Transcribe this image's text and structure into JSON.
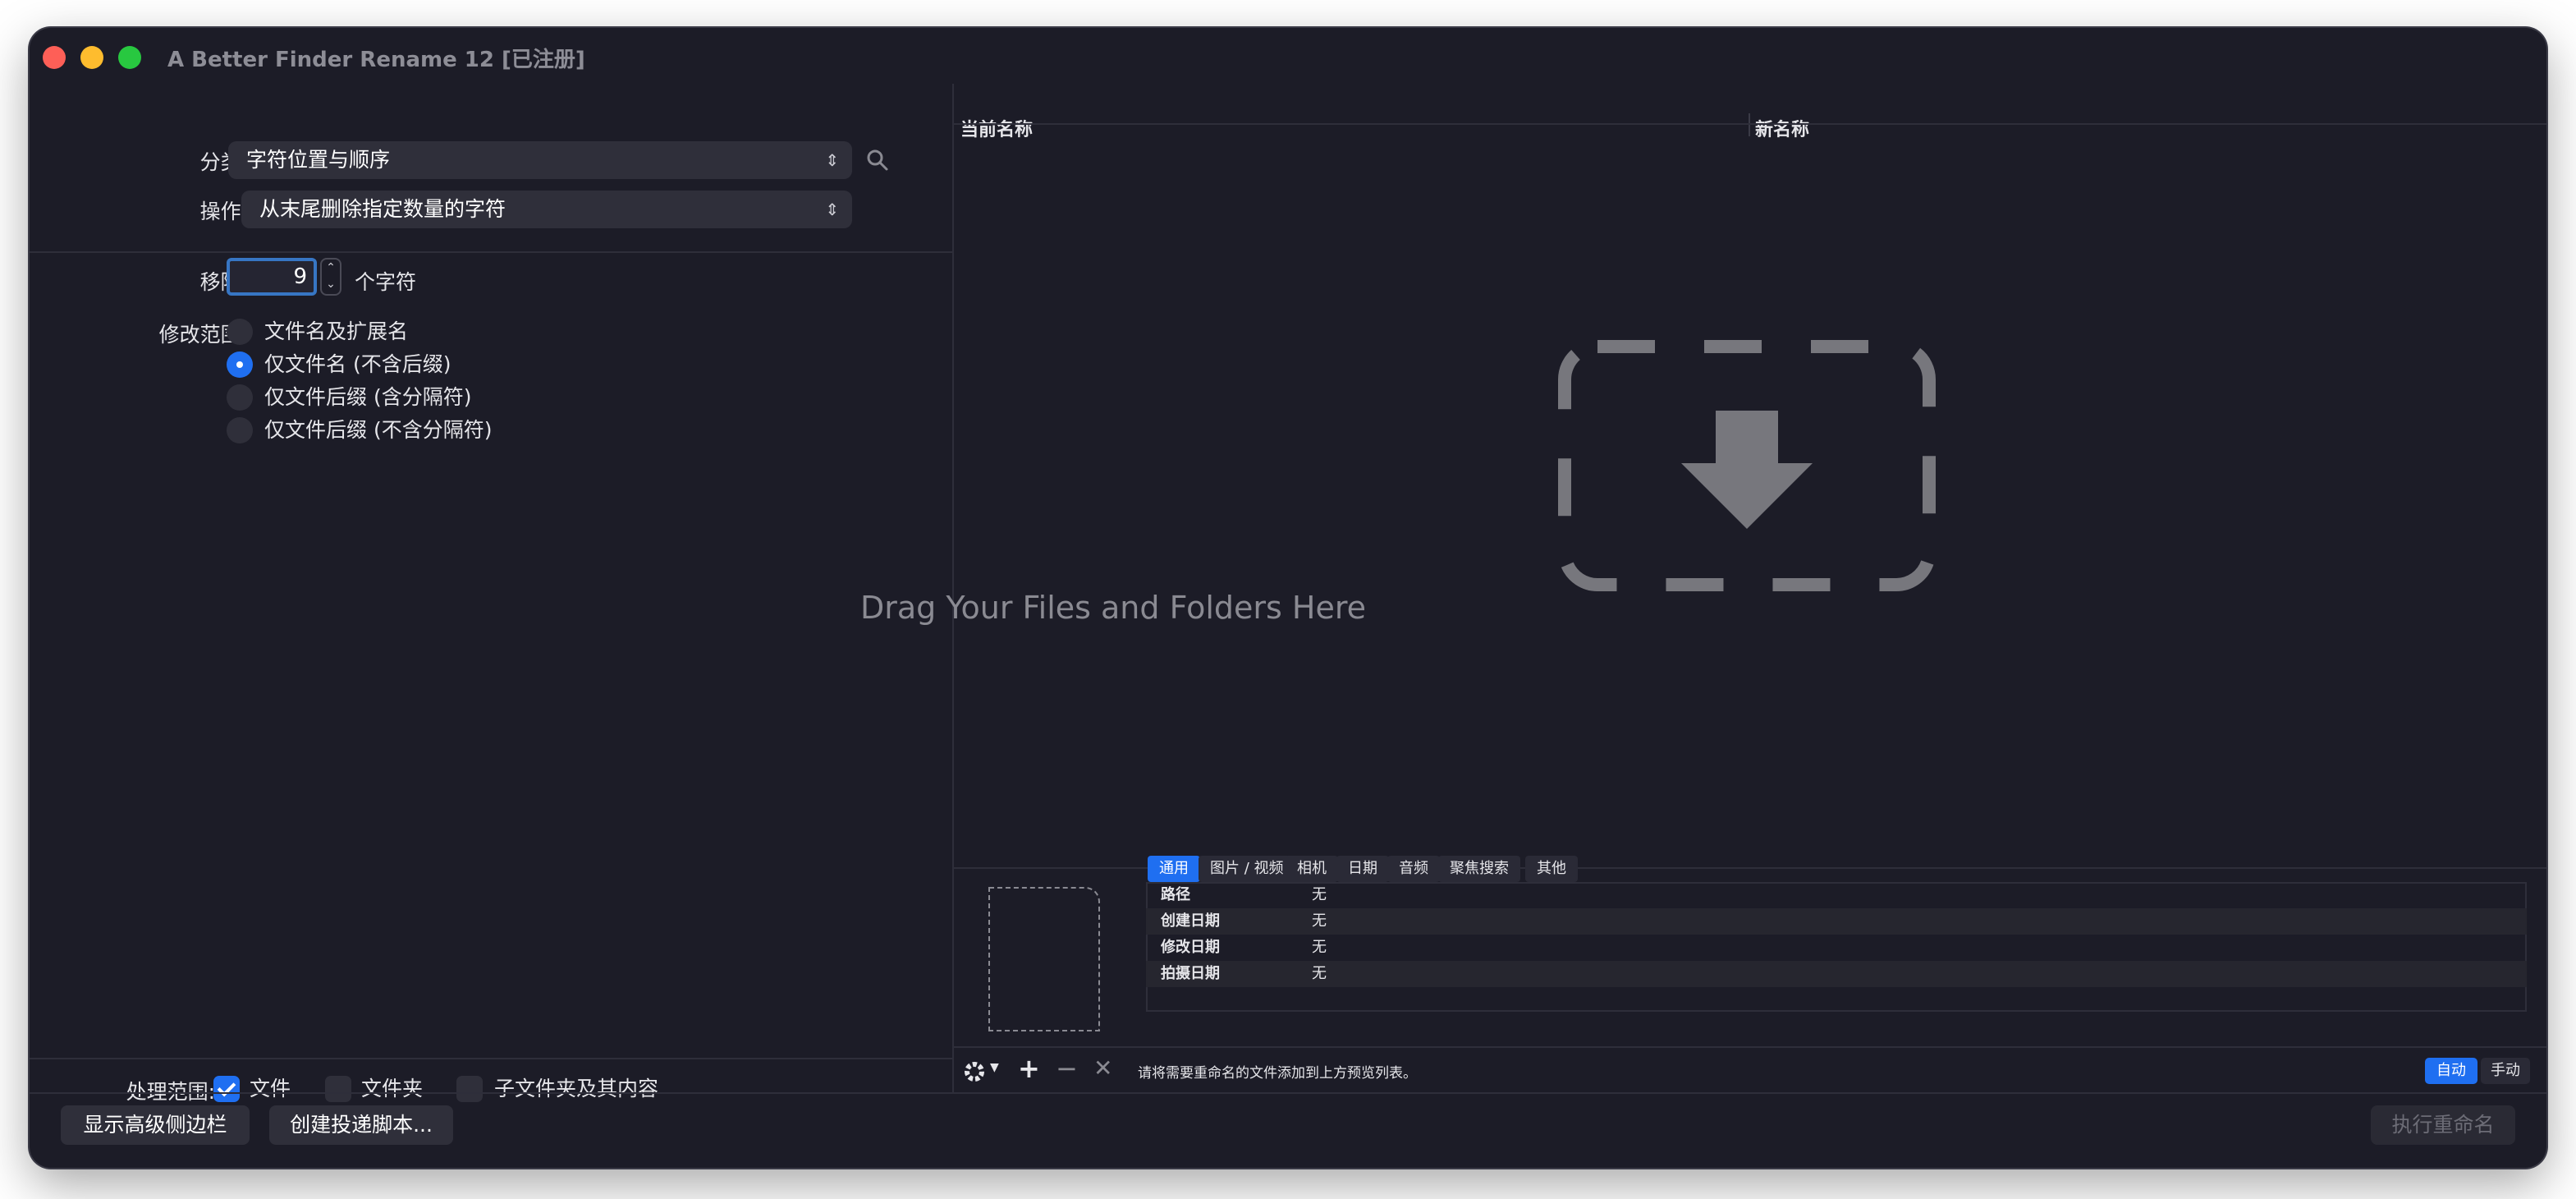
{
  "window": {
    "title": "A Better Finder Rename 12 [已注册]"
  },
  "left": {
    "category_label": "分类:",
    "category_value": "字符位置与顺序",
    "action_label": "操作:",
    "action_value": "从末尾删除指定数量的字符",
    "remove_label": "移除:",
    "remove_value": "9",
    "remove_unit": "个字符",
    "scope_label": "修改范围:",
    "scope_options": [
      "文件名及扩展名",
      "仅文件名 (不含后缀)",
      "仅文件后缀 (含分隔符)",
      "仅文件后缀 (不含分隔符)"
    ],
    "scope_selected": 1,
    "process_label": "处理范围:",
    "process_options": [
      {
        "label": "文件",
        "checked": true
      },
      {
        "label": "文件夹",
        "checked": false
      },
      {
        "label": "子文件夹及其内容",
        "checked": false
      }
    ]
  },
  "right": {
    "col_current": "当前名称",
    "col_new": "新名称",
    "drop_hint": "Drag Your Files and Folders Here",
    "tabs": [
      "通用",
      "图片 / 视频",
      "相机",
      "日期",
      "音频",
      "聚焦搜索",
      "其他"
    ],
    "active_tab": 0,
    "info_rows": [
      {
        "key": "路径",
        "value": "无"
      },
      {
        "key": "创建日期",
        "value": "无"
      },
      {
        "key": "修改日期",
        "value": "无"
      },
      {
        "key": "拍摄日期",
        "value": "无"
      }
    ],
    "status_text": "请将需要重命名的文件添加到上方预览列表。",
    "mode_auto": "自动",
    "mode_manual": "手动"
  },
  "bottom": {
    "advanced_button": "显示高级侧边栏",
    "droplet_button": "创建投递脚本...",
    "rename_button": "执行重命名"
  },
  "colors": {
    "accent": "#1f6ff1",
    "window_bg": "#1c1c27"
  }
}
